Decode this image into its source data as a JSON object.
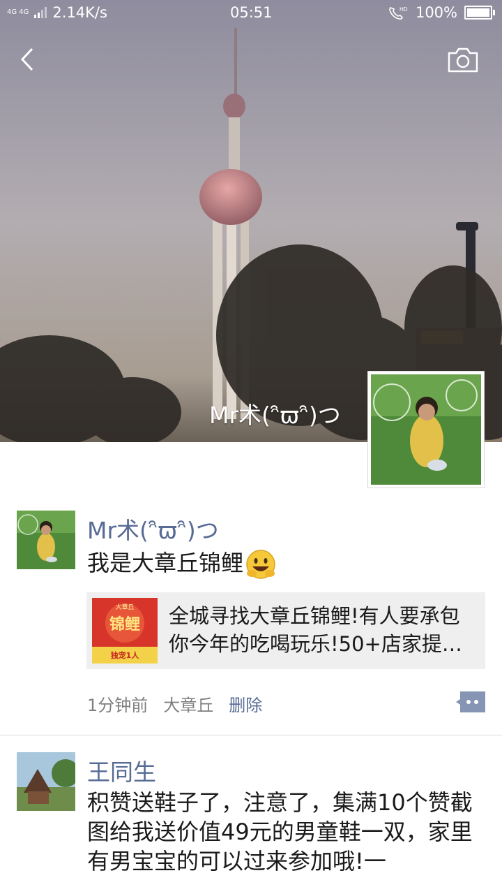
{
  "status_bar": {
    "network": "4G 4G",
    "speed": "2.14K/s",
    "time": "05:51",
    "hd": "HD",
    "battery": "100%"
  },
  "header": {
    "back_icon": "chevron-left-icon",
    "camera_icon": "camera-icon"
  },
  "profile": {
    "name": "Mr术(ᵔ̑ϖᵔ̑)つ"
  },
  "posts": [
    {
      "author": "Mr术(ᵔ̑ϖᵔ̑)つ",
      "text": "我是大章丘锦鲤",
      "emoji": "grinning-face-emoji",
      "link": {
        "title": "全城寻找大章丘锦鲤!有人要承包你今年的吃喝玩乐!50+店家提…",
        "thumb_top": "大章丘",
        "thumb_main": "锦鲤",
        "thumb_bottom": "独宠1人"
      },
      "time": "1分钟前",
      "location": "大章丘",
      "delete_label": "删除"
    },
    {
      "author": "王同生",
      "text": "积赞送鞋子了，注意了，集满10个赞截图给我送价值49元的男童鞋一双，家里有男宝宝的可以过来参加哦!一"
    }
  ],
  "colors": {
    "link_blue": "#576b95",
    "meta_gray": "#7f7f7f",
    "card_bg": "#efefef"
  }
}
